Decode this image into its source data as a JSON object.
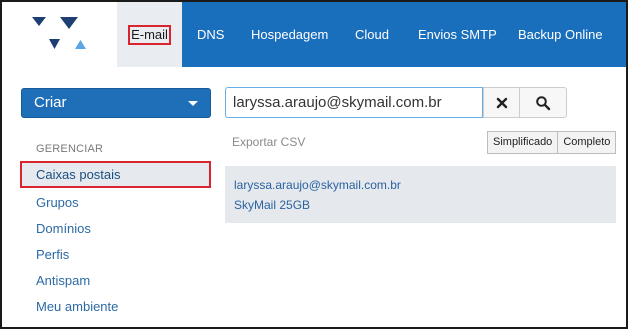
{
  "nav": {
    "logo": "logo-icon",
    "items": [
      {
        "label": "E-mail",
        "active": true
      },
      {
        "label": "DNS"
      },
      {
        "label": "Hospedagem"
      },
      {
        "label": "Cloud"
      },
      {
        "label": "Envios SMTP"
      },
      {
        "label": "Backup Online"
      }
    ]
  },
  "sidebar": {
    "create_label": "Criar",
    "heading": "GERENCIAR",
    "items": [
      {
        "label": "Caixas postais",
        "active": true
      },
      {
        "label": "Grupos"
      },
      {
        "label": "Domínios"
      },
      {
        "label": "Perfis"
      },
      {
        "label": "Antispam"
      },
      {
        "label": "Meu ambiente"
      }
    ]
  },
  "search": {
    "value": "laryssa.araujo@skymail.com.br",
    "clear_icon": "close-icon",
    "search_icon": "search-icon"
  },
  "toolbar": {
    "export_label": "Exportar CSV",
    "views": [
      "Simplificado",
      "Completo"
    ]
  },
  "results": [
    {
      "email": "laryssa.araujo@skymail.com.br",
      "plan": "SkyMail 25GB"
    }
  ],
  "colors": {
    "nav_bg": "#1a6fbd",
    "accent": "#1f6eb8",
    "highlight": "#d9232e"
  }
}
